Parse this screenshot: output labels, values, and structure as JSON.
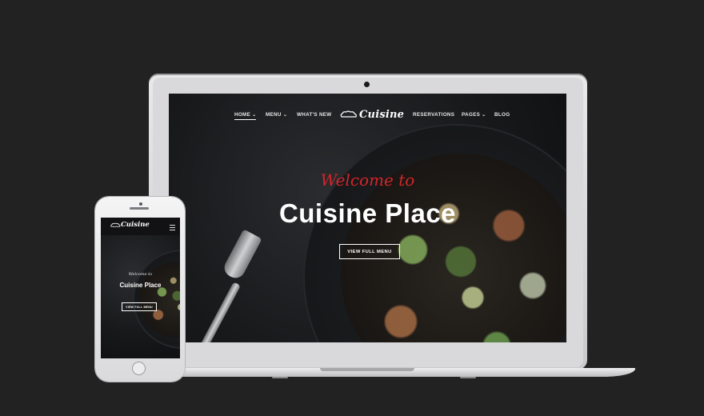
{
  "laptop": {
    "nav": {
      "items": [
        {
          "label": "HOME",
          "dropdown": true,
          "active": true
        },
        {
          "label": "MENU",
          "dropdown": true,
          "active": false
        },
        {
          "label": "WHAT'S NEW",
          "dropdown": false,
          "active": false
        },
        {
          "label": "RESERVATIONS",
          "dropdown": false,
          "active": false
        },
        {
          "label": "PAGES",
          "dropdown": true,
          "active": false
        },
        {
          "label": "BLOG",
          "dropdown": false,
          "active": false
        }
      ],
      "caret": "⌄"
    },
    "logo_text": "Cuisine",
    "hero": {
      "welcome": "Welcome to",
      "title": "Cuisine Place",
      "button_label": "VIEW FULL MENU"
    }
  },
  "phone": {
    "logo_text": "Cuisine",
    "hero": {
      "welcome": "Welcome to",
      "title": "Cuisine Place",
      "button_label": "VIEW FULL MENU"
    }
  },
  "colors": {
    "background": "#222222",
    "accent_red": "#d3262a",
    "text_white": "#ffffff"
  },
  "icons": [
    "chef-hat-logo-icon",
    "chevron-down-icon",
    "hamburger-menu-icon"
  ]
}
